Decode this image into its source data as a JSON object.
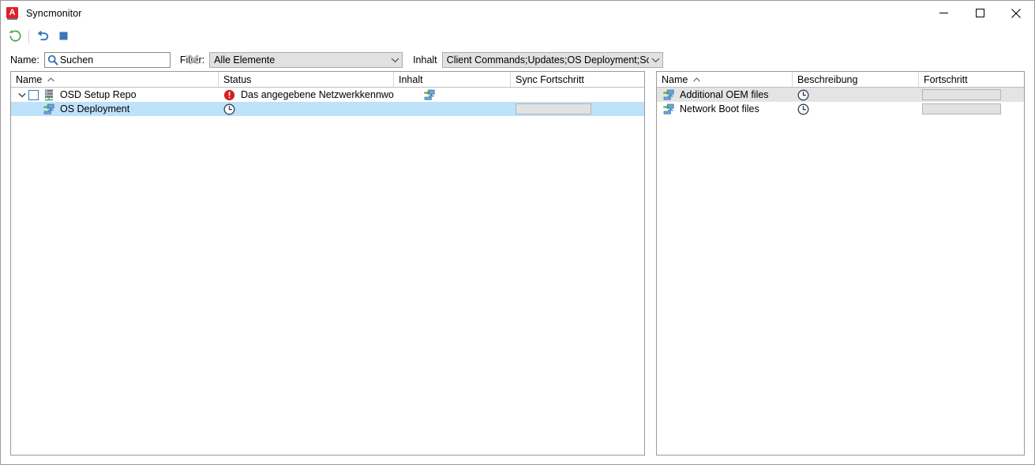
{
  "window": {
    "title": "Syncmonitor",
    "app_icon": "aagon-a-logo-icon",
    "logo_letter": "A",
    "controls": {
      "minimize": "minimize-button",
      "maximize": "maximize-button",
      "close": "close-button"
    }
  },
  "toolbar": {
    "buttons": [
      {
        "name": "refresh-sync-button",
        "icon": "refresh-circular-arrow-icon",
        "color": "#4ba64b"
      },
      {
        "name": "undo-button",
        "icon": "undo-arrow-icon",
        "color": "#2e75b6"
      },
      {
        "name": "stop-button",
        "icon": "stop-square-icon",
        "color": "#3a76b8"
      }
    ]
  },
  "filter_bar": {
    "name_label": "Name:",
    "search_placeholder": "Suchen",
    "search_value": "",
    "search_icon": "magnifier-icon",
    "clear_icon": "clear-x-icon",
    "filter_label": "Filter:",
    "filter_value": "Alle Elemente",
    "content_label": "Inhalt",
    "content_value": "Client Commands;Updates;OS Deployment;Schwachst"
  },
  "left_grid": {
    "columns": [
      {
        "label": "Name",
        "sorted": "asc"
      },
      {
        "label": "Status",
        "sorted": ""
      },
      {
        "label": "Inhalt",
        "sorted": ""
      },
      {
        "label": "Sync Fortschritt",
        "sorted": ""
      }
    ],
    "rows": [
      {
        "name": "OSD Setup Repo",
        "icon": "server-repository-icon",
        "expander": "chevron-down-icon",
        "checkbox": "unchecked",
        "status_icon": "error-exclamation-icon",
        "status": "Das angegebene Netzwerkkennwort i...",
        "content_icon": "os-deployment-icon",
        "progress": null,
        "selected": false,
        "indent": 0
      },
      {
        "name": "OS Deployment",
        "icon": "os-deployment-icon",
        "expander": "",
        "checkbox": "",
        "status_icon": "clock-pending-icon",
        "status": "",
        "content_icon": "",
        "progress": 0,
        "selected": true,
        "indent": 1
      }
    ]
  },
  "right_grid": {
    "columns": [
      {
        "label": "Name",
        "sorted": "asc"
      },
      {
        "label": "Beschreibung",
        "sorted": ""
      },
      {
        "label": "Fortschritt",
        "sorted": ""
      }
    ],
    "rows": [
      {
        "name": "Additional OEM files",
        "icon": "os-deployment-icon",
        "desc_icon": "clock-pending-icon",
        "description": "",
        "progress": 0,
        "selected": true
      },
      {
        "name": "Network Boot files",
        "icon": "os-deployment-icon",
        "desc_icon": "clock-pending-icon",
        "description": "",
        "progress": 0,
        "selected": false
      }
    ]
  },
  "colors": {
    "selection_blue": "#bfe2fb",
    "soft_selection": "#e4e4e4",
    "error_red": "#d32020",
    "brand_red": "#e0202a",
    "icon_blue": "#3a76b8",
    "icon_green": "#4ba64b",
    "border_gray": "#9a9a9a"
  }
}
